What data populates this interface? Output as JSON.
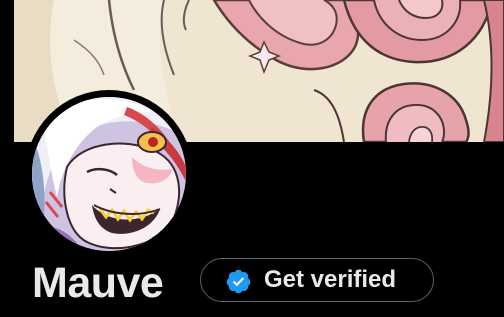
{
  "profile": {
    "display_name": "Mauve",
    "banner_icon": "banner-artwork",
    "avatar_icon": "avatar-artwork"
  },
  "verify": {
    "label": "Get verified",
    "icon": "verified-badge-icon",
    "badge_color": "#1d9bf0"
  },
  "colors": {
    "background": "#000000",
    "text": "#e7e9ea",
    "button_border": "#536471"
  }
}
